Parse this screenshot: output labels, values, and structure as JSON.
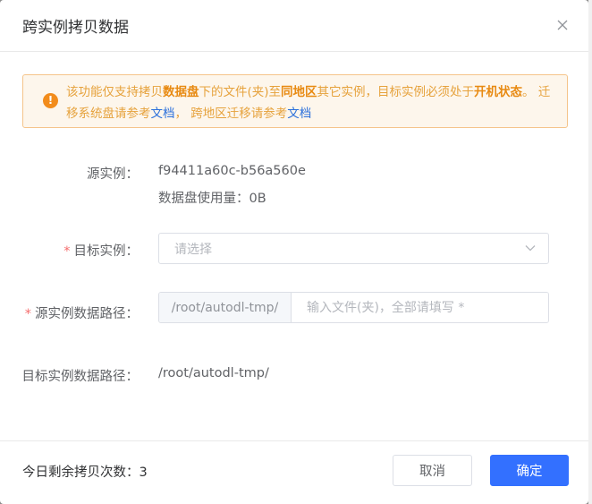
{
  "dialog": {
    "title": "跨实例拷贝数据"
  },
  "alert": {
    "t1": "该功能仅支持拷贝",
    "b1": "数据盘",
    "t2": "下的文件(夹)至",
    "b2": "同地区",
    "t3": "其它实例，目标实例必须处于",
    "b3": "开机状态",
    "t4": "。 迁移系统盘请参考",
    "link1": "文档",
    "t5": "， 跨地区迁移请参考",
    "link2": "文档"
  },
  "form": {
    "source_label": "源实例：",
    "source_id": "f94411a60c-b56a560e",
    "disk_usage": "数据盘使用量：0B",
    "target_label": "目标实例：",
    "target_placeholder": "请选择",
    "srcpath_label": "源实例数据路径：",
    "srcpath_prefix": "/root/autodl-tmp/",
    "srcpath_placeholder": "输入文件(夹)，全部请填写 *",
    "dstpath_label": "目标实例数据路径：",
    "dstpath_value": "/root/autodl-tmp/",
    "required_mark": "*"
  },
  "footer": {
    "remaining": "今日剩余拷贝次数：3",
    "cancel_label": "取消",
    "confirm_label": "确定"
  },
  "colors": {
    "primary": "#3370ff",
    "warning": "#e6a23c",
    "required": "#f56c6c"
  },
  "icons": [
    "close-icon",
    "warning-icon",
    "chevron-down-icon"
  ]
}
